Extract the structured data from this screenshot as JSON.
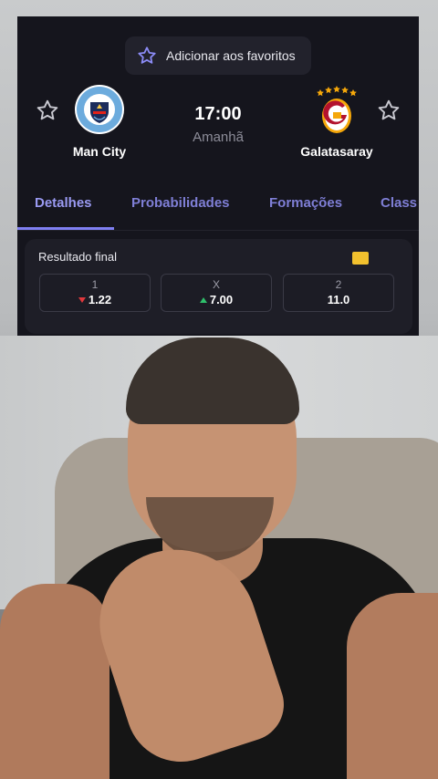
{
  "match_card": {
    "favorite_button_label": "Adicionar aos favoritos",
    "home_team": {
      "name": "Man City",
      "crest_text": "MANCHESTER CITY",
      "crest_color": "#6cabdd"
    },
    "away_team": {
      "name": "Galatasaray",
      "crest_color": "#f5a70a",
      "crest_accent": "#b3122e"
    },
    "kickoff_time": "17:00",
    "kickoff_day": "Amanhã",
    "tabs": [
      {
        "label": "Detalhes",
        "active": true
      },
      {
        "label": "Probabilidades",
        "active": false
      },
      {
        "label": "Formações",
        "active": false
      },
      {
        "label": "Class",
        "active": false
      }
    ],
    "market": {
      "title": "Resultado final",
      "odds": [
        {
          "selection": "1",
          "value": "1.22",
          "trend": "down"
        },
        {
          "selection": "X",
          "value": "7.00",
          "trend": "up"
        },
        {
          "selection": "2",
          "value": "11.0",
          "trend": "none"
        }
      ]
    }
  },
  "colors": {
    "accent": "#7f7ff2",
    "card_bg": "#15151d",
    "down": "#e0383c",
    "up": "#2fc06b"
  },
  "icons": [
    "star-outline-icon",
    "man-city-crest-icon",
    "galatasaray-crest-icon",
    "flag-icon",
    "trend-down-icon",
    "trend-up-icon"
  ]
}
